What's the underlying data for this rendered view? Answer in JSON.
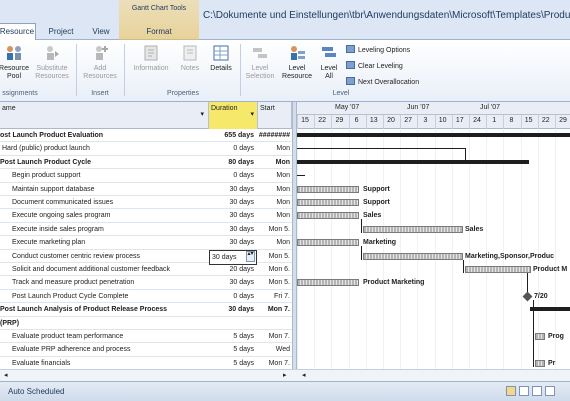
{
  "tabs": [
    {
      "label": "Resource",
      "active": true
    },
    {
      "label": "Project",
      "active": false
    },
    {
      "label": "View",
      "active": false
    },
    {
      "label": "Format",
      "active": false
    }
  ],
  "context_tab": "Gantt Chart Tools",
  "window_title": "C:\\Dokumente und Einstellungen\\tbr\\Anwendungsdaten\\Microsoft\\Templates\\Product eva",
  "ribbon": {
    "resource_pool": "Resource Pool",
    "substitute": "Substitute Resources",
    "add": "Add Resources",
    "information": "Information",
    "notes": "Notes",
    "details": "Details",
    "level_selection": "Level Selection",
    "level_resource": "Level Resource",
    "level_all": "Level All",
    "leveling_options": "Leveling Options",
    "clear_leveling": "Clear Leveling",
    "next_overallocation": "Next Overallocation",
    "groups": {
      "assignments": "ssignments",
      "insert": "Insert",
      "properties": "Properties",
      "level": "Level"
    }
  },
  "columns": {
    "name": "ame",
    "duration": "Duration",
    "start": "Start"
  },
  "timescale": {
    "months": [
      "May '07",
      "Jun '07",
      "Jul '07"
    ],
    "days": [
      "15",
      "22",
      "29",
      "6",
      "13",
      "20",
      "27",
      "3",
      "10",
      "17",
      "24",
      "1",
      "8",
      "15",
      "22",
      "29"
    ]
  },
  "rows": [
    {
      "name": "ost Launch Product Evaluation",
      "duration": "655 days",
      "start": "########",
      "bold": true,
      "indent": 0
    },
    {
      "name": "Hard (public) product launch",
      "duration": "0 days",
      "start": "Mon",
      "bold": false,
      "indent": 1
    },
    {
      "name": "Post Launch Product Cycle",
      "duration": "80 days",
      "start": "Mon",
      "bold": true,
      "indent": 0
    },
    {
      "name": "Begin product support",
      "duration": "0 days",
      "start": "Mon",
      "bold": false,
      "indent": 2
    },
    {
      "name": "Maintain support database",
      "duration": "30 days",
      "start": "Mon",
      "bold": false,
      "indent": 2
    },
    {
      "name": "Document communicated issues",
      "duration": "30 days",
      "start": "Mon",
      "bold": false,
      "indent": 2
    },
    {
      "name": "Execute ongoing sales program",
      "duration": "30 days",
      "start": "Mon",
      "bold": false,
      "indent": 2
    },
    {
      "name": "Execute inside sales program",
      "duration": "30 days",
      "start": "Mon 5.",
      "bold": false,
      "indent": 2
    },
    {
      "name": "Execute marketing plan",
      "duration": "30 days",
      "start": "Mon",
      "bold": false,
      "indent": 2
    },
    {
      "name": "Conduct customer centric review process",
      "duration": "30 days",
      "start": "Mon 5.",
      "bold": false,
      "indent": 2,
      "editing": true
    },
    {
      "name": "Solicit and document additional customer feedback",
      "duration": "20 days",
      "start": "Mon 6.",
      "bold": false,
      "indent": 2
    },
    {
      "name": "Track and measure product penetration",
      "duration": "30 days",
      "start": "Mon 5.",
      "bold": false,
      "indent": 2
    },
    {
      "name": "Post Launch Product Cycle Complete",
      "duration": "0 days",
      "start": "Fri 7.",
      "bold": false,
      "indent": 2
    },
    {
      "name": "Post Launch Analysis of Product Release Process",
      "duration": "30 days",
      "start": "Mon 7.",
      "bold": true,
      "indent": 0
    },
    {
      "name": "(PRP)",
      "duration": "",
      "start": "",
      "bold": true,
      "indent": 0
    },
    {
      "name": "Evaluate product team performance",
      "duration": "5 days",
      "start": "Mon 7.",
      "bold": false,
      "indent": 2
    },
    {
      "name": "Evaluate PRP adherence and process",
      "duration": "5 days",
      "start": "Wed",
      "bold": false,
      "indent": 2
    },
    {
      "name": "Evaluate financials",
      "duration": "5 days",
      "start": "Mon 7.",
      "bold": false,
      "indent": 2
    }
  ],
  "gantt_labels": {
    "support1": "Support",
    "support2": "Support",
    "sales": "Sales",
    "sales2": "Sales",
    "marketing": "Marketing",
    "combined": "Marketing,Sponsor,Produc",
    "product_m": "Product M",
    "product_marketing": "Product Marketing",
    "milestone_date": "7/20",
    "prog1": "Prog",
    "prog2": "Pr"
  },
  "status": "Auto Scheduled"
}
